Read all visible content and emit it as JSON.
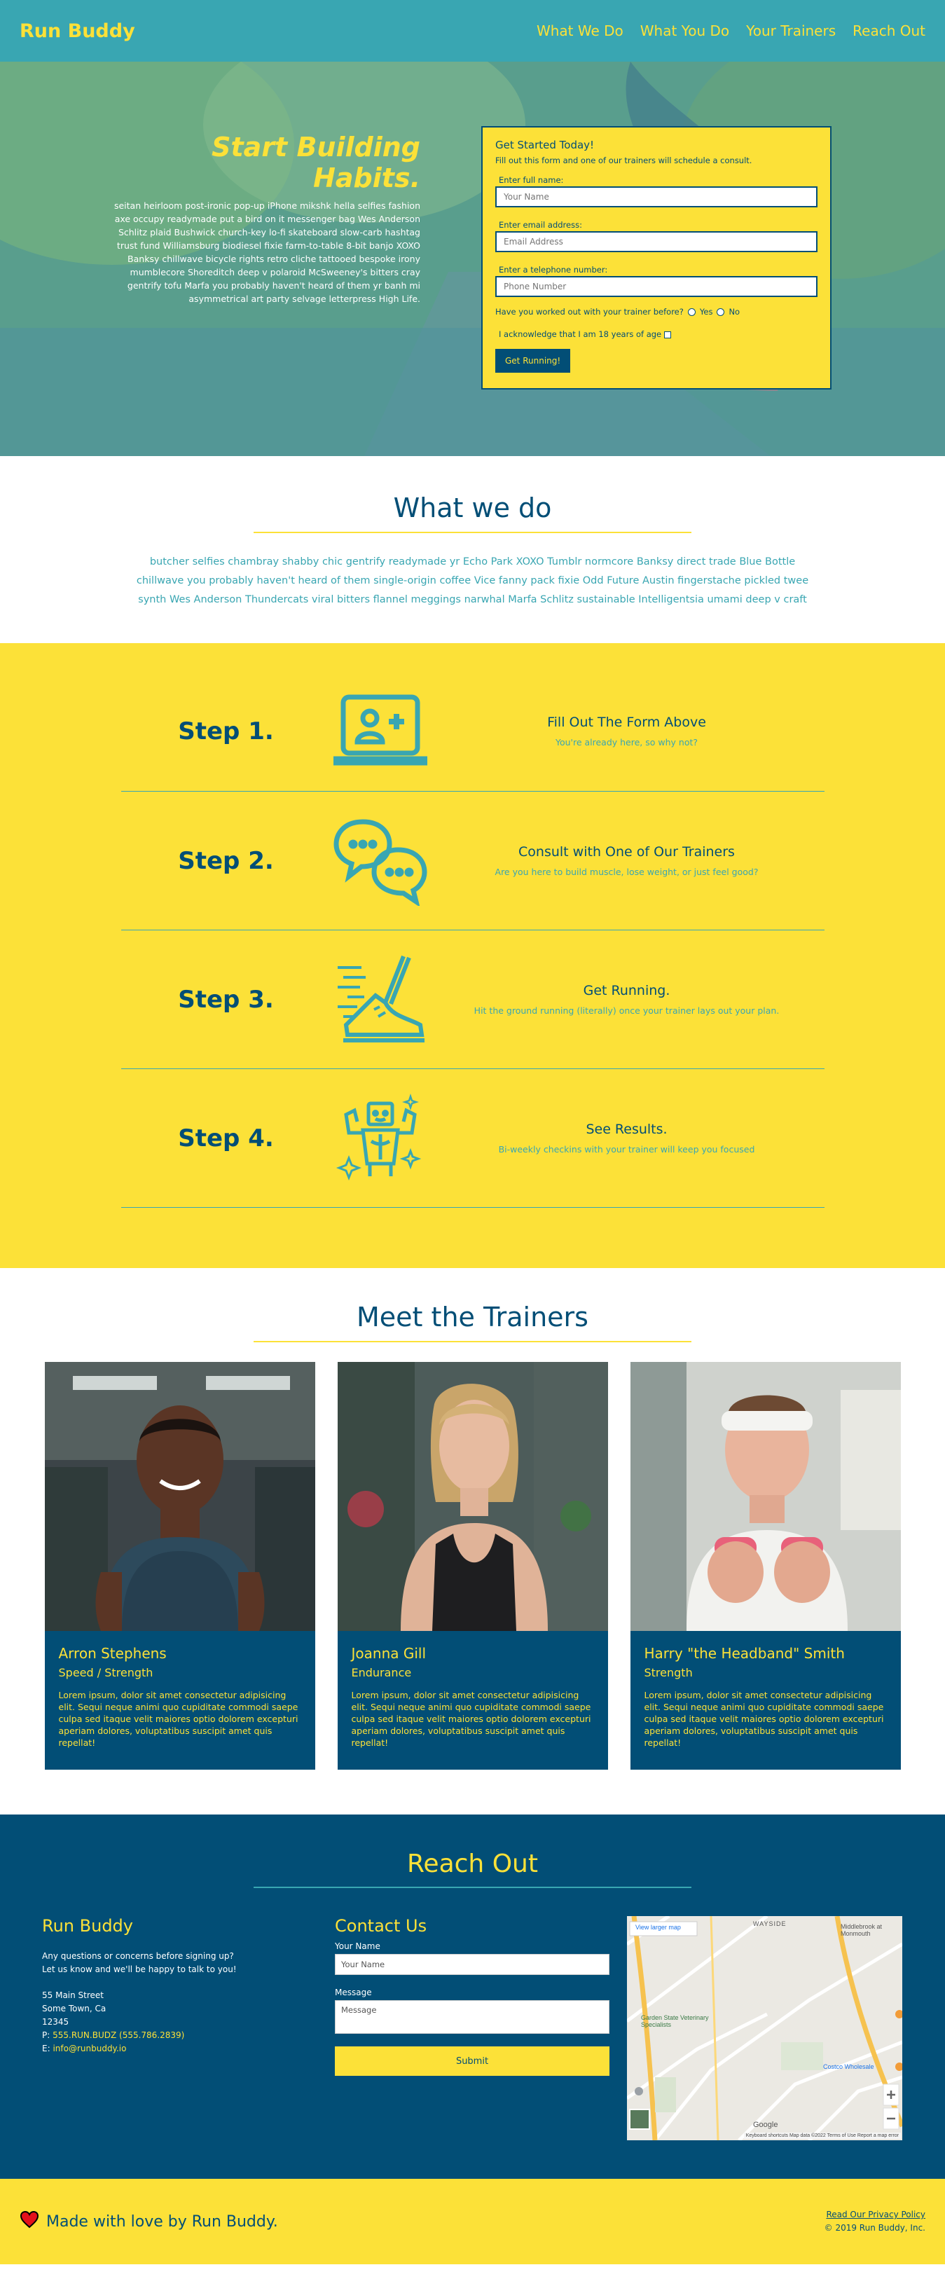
{
  "header": {
    "brand": "Run Buddy",
    "nav": [
      "What We Do",
      "What You Do",
      "Your Trainers",
      "Reach Out"
    ]
  },
  "hero": {
    "headline": "Start Building Habits.",
    "text": "seitan heirloom post-ironic pop-up iPhone mikshk hella selfies fashion axe occupy readymade put a bird on it messenger bag Wes Anderson Schlitz plaid Bushwick church-key lo-fi skateboard slow-carb hashtag trust fund Williamsburg biodiesel fixie farm-to-table 8-bit banjo XOXO Banksy chillwave bicycle rights retro cliche tattooed bespoke irony mumblecore Shoreditch deep v polaroid McSweeney's bitters cray gentrify tofu Marfa you probably haven't heard of them yr banh mi asymmetrical art party selvage letterpress High Life.",
    "form": {
      "title": "Get Started Today!",
      "intro": "Fill out this form and one of our trainers will schedule a consult.",
      "name_label": "Enter full name:",
      "name_placeholder": "Your Name",
      "email_label": "Enter email address:",
      "email_placeholder": "Email Address",
      "phone_label": "Enter a telephone number:",
      "phone_placeholder": "Phone Number",
      "question": "Have you worked out with your trainer before?",
      "yes": "Yes",
      "no": "No",
      "acknowledge": "I acknowledge that I am 18 years of age",
      "submit": "Get Running!"
    }
  },
  "what_we_do": {
    "title": "What we do",
    "text": "butcher selfies chambray shabby chic gentrify readymade yr Echo Park XOXO Tumblr normcore Banksy direct trade Blue Bottle chillwave you probably haven't heard of them single-origin coffee Vice fanny pack fixie Odd Future Austin fingerstache pickled twee synth Wes Anderson Thundercats viral bitters flannel meggings narwhal Marfa Schlitz sustainable Intelligentsia umami deep v craft"
  },
  "steps": [
    {
      "number": "Step 1.",
      "title": "Fill Out The Form Above",
      "text": "You're already here, so why not?",
      "icon": "laptop-user-icon"
    },
    {
      "number": "Step 2.",
      "title": "Consult with One of Our Trainers",
      "text": "Are you here to build muscle, lose weight, or just feel good?",
      "icon": "chat-bubbles-icon"
    },
    {
      "number": "Step 3.",
      "title": "Get Running.",
      "text": "Hit the ground running (literally) once your trainer lays out your plan.",
      "icon": "running-shoe-icon"
    },
    {
      "number": "Step 4.",
      "title": "See Results.",
      "text": "Bi-weekly checkins with your trainer will keep you focused",
      "icon": "strong-robot-icon"
    }
  ],
  "trainers": {
    "title": "Meet the Trainers",
    "list": [
      {
        "name": "Arron Stephens",
        "role": "Speed / Strength",
        "bio": "Lorem ipsum, dolor sit amet consectetur adipisicing elit. Sequi neque animi quo cupiditate commodi saepe culpa sed itaque velit maiores optio dolorem excepturi aperiam dolores, voluptatibus suscipit amet quis repellat!"
      },
      {
        "name": "Joanna Gill",
        "role": "Endurance",
        "bio": "Lorem ipsum, dolor sit amet consectetur adipisicing elit. Sequi neque animi quo cupiditate commodi saepe culpa sed itaque velit maiores optio dolorem excepturi aperiam dolores, voluptatibus suscipit amet quis repellat!"
      },
      {
        "name": "Harry \"the Headband\" Smith",
        "role": "Strength",
        "bio": "Lorem ipsum, dolor sit amet consectetur adipisicing elit. Sequi neque animi quo cupiditate commodi saepe culpa sed itaque velit maiores optio dolorem excepturi aperiam dolores, voluptatibus suscipit amet quis repellat!"
      }
    ]
  },
  "reach_out": {
    "title": "Reach Out",
    "brand": "Run Buddy",
    "blurb1": "Any questions or concerns before signing up?",
    "blurb2": "Let us know and we'll be happy to talk to you!",
    "address1": "55 Main Street",
    "address2": "Some Town, Ca",
    "zip": "12345",
    "phone_prefix": "P: ",
    "phone": "555.RUN.BUDZ (555.786.2839)",
    "email_prefix": "E: ",
    "email": "info@runbuddy.io",
    "contact_title": "Contact Us",
    "name_label": "Your Name",
    "name_placeholder": "Your Name",
    "message_label": "Message",
    "message_placeholder": "Message",
    "submit": "Submit",
    "map": {
      "larger_link": "View larger map",
      "labels": [
        "WAYSIDE",
        "Middlebrook at Monmouth",
        "Garden State Veterinary Specialists",
        "Costco Wholesale"
      ],
      "attribution": [
        "Keyboard shortcuts",
        "Map data ©2022",
        "Terms of Use",
        "Report a map error"
      ],
      "logo": "Google"
    }
  },
  "footer": {
    "made_with": "Made with love by Run Buddy.",
    "privacy": "Read Our Privacy Policy",
    "copyright": "© 2019 Run Buddy, Inc."
  },
  "colors": {
    "teal": "#39a6b2",
    "yellow": "#fce138",
    "navy": "#024e76",
    "heart": "#e4111b"
  }
}
